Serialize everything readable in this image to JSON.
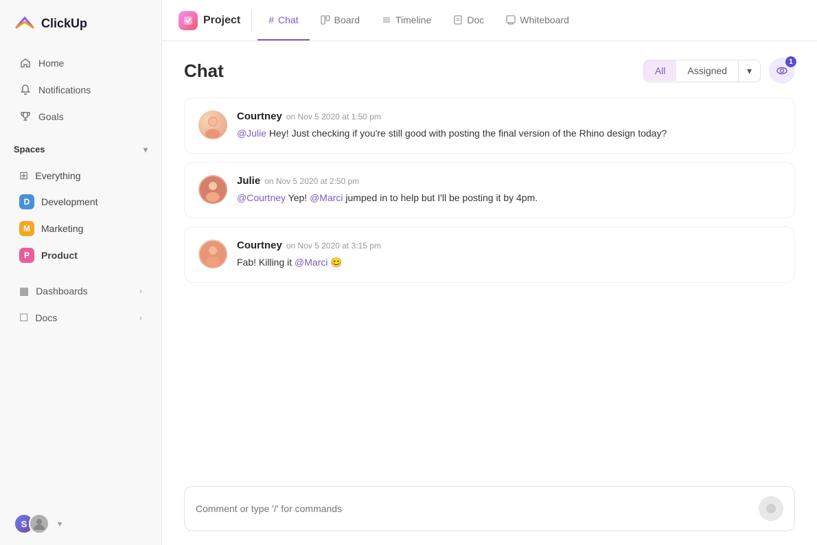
{
  "app": {
    "name": "ClickUp"
  },
  "sidebar": {
    "nav": [
      {
        "id": "home",
        "label": "Home",
        "icon": "home"
      },
      {
        "id": "notifications",
        "label": "Notifications",
        "icon": "bell"
      },
      {
        "id": "goals",
        "label": "Goals",
        "icon": "trophy"
      }
    ],
    "spaces_label": "Spaces",
    "spaces": [
      {
        "id": "everything",
        "label": "Everything",
        "type": "grid"
      },
      {
        "id": "development",
        "label": "Development",
        "badge": "D",
        "color": "#4a90d9"
      },
      {
        "id": "marketing",
        "label": "Marketing",
        "badge": "M",
        "color": "#f5a623"
      },
      {
        "id": "product",
        "label": "Product",
        "badge": "P",
        "color": "#e85d9a",
        "active": true
      }
    ],
    "collapse_items": [
      {
        "id": "dashboards",
        "label": "Dashboards"
      },
      {
        "id": "docs",
        "label": "Docs"
      }
    ],
    "bottom": {
      "user_initial": "S"
    }
  },
  "topbar": {
    "project_label": "Project",
    "tabs": [
      {
        "id": "chat",
        "label": "Chat",
        "icon": "#",
        "active": true
      },
      {
        "id": "board",
        "label": "Board",
        "icon": "▦"
      },
      {
        "id": "timeline",
        "label": "Timeline",
        "icon": "≡"
      },
      {
        "id": "doc",
        "label": "Doc",
        "icon": "☐"
      },
      {
        "id": "whiteboard",
        "label": "Whiteboard",
        "icon": "✎"
      }
    ]
  },
  "chat": {
    "title": "Chat",
    "filters": {
      "all_label": "All",
      "assigned_label": "Assigned"
    },
    "watchers_count": "1",
    "messages": [
      {
        "id": "msg1",
        "author": "Courtney",
        "time": "on Nov 5 2020 at 1:50 pm",
        "text_parts": [
          {
            "type": "mention",
            "value": "@Julie"
          },
          {
            "type": "text",
            "value": " Hey! Just checking if you're still good with posting the final version of the Rhino design today?"
          }
        ]
      },
      {
        "id": "msg2",
        "author": "Julie",
        "time": "on Nov 5 2020 at 2:50 pm",
        "text_parts": [
          {
            "type": "mention",
            "value": "@Courtney"
          },
          {
            "type": "text",
            "value": " Yep! "
          },
          {
            "type": "mention",
            "value": "@Marci"
          },
          {
            "type": "text",
            "value": " jumped in to help but I'll be posting it by 4pm."
          }
        ]
      },
      {
        "id": "msg3",
        "author": "Courtney",
        "time": "on Nov 5 2020 at 3:15 pm",
        "text_parts": [
          {
            "type": "text",
            "value": "Fab! Killing it "
          },
          {
            "type": "mention",
            "value": "@Marci"
          },
          {
            "type": "text",
            "value": " 😊"
          }
        ]
      }
    ],
    "input_placeholder": "Comment or type '/' for commands"
  }
}
